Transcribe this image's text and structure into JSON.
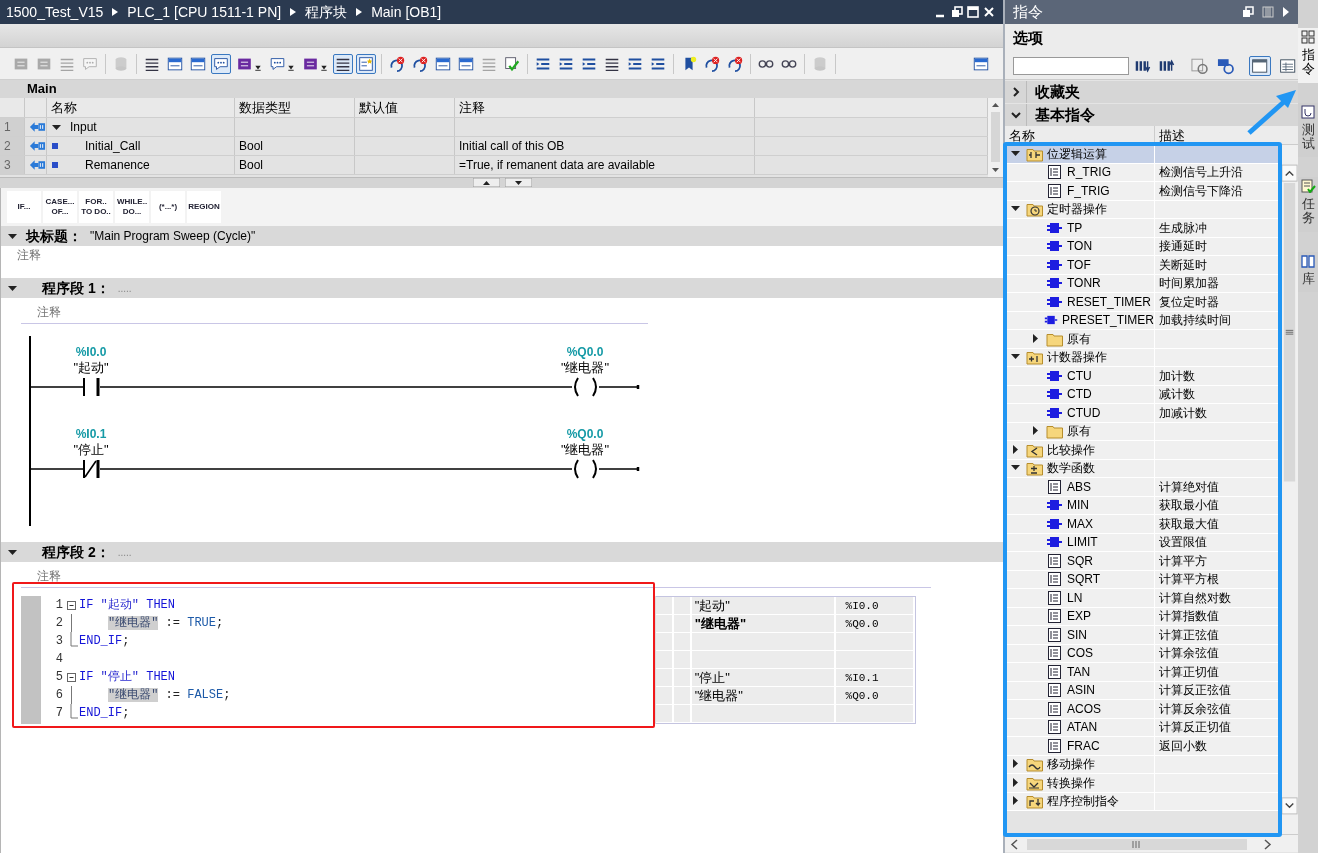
{
  "title_bar": {
    "breadcrumb": [
      "1500_Test_V15",
      "PLC_1 [CPU 1511-1 PN]",
      "程序块",
      "Main [OB1]"
    ]
  },
  "toolbar": [
    {
      "buttons": [
        {
          "on": false,
          "disabled": true,
          "kind": "button"
        },
        {
          "on": false,
          "disabled": true,
          "kind": "button"
        },
        {
          "on": false,
          "disabled": true,
          "kind": "button"
        },
        {
          "on": false,
          "disabled": true,
          "kind": "button"
        }
      ]
    },
    {
      "buttons": [
        {
          "on": false,
          "disabled": true,
          "kind": "button"
        }
      ]
    },
    {
      "buttons": [
        {
          "on": false,
          "disabled": false,
          "kind": "button"
        },
        {
          "on": false,
          "disabled": false,
          "kind": "button"
        },
        {
          "on": false,
          "disabled": false,
          "kind": "button"
        },
        {
          "on": true,
          "disabled": false,
          "kind": "button"
        },
        {
          "on": false,
          "disabled": false,
          "kind": "dropdown"
        },
        {
          "on": false,
          "disabled": false,
          "kind": "dropdown"
        },
        {
          "on": false,
          "disabled": false,
          "kind": "dropdown"
        },
        {
          "on": true,
          "disabled": false,
          "kind": "button"
        },
        {
          "on": true,
          "disabled": false,
          "kind": "button"
        }
      ]
    },
    {
      "buttons": [
        {
          "on": false,
          "disabled": false,
          "kind": "button"
        },
        {
          "on": false,
          "disabled": false,
          "kind": "button"
        },
        {
          "on": false,
          "disabled": false,
          "kind": "button"
        },
        {
          "on": false,
          "disabled": false,
          "kind": "button"
        },
        {
          "on": false,
          "disabled": true,
          "kind": "button"
        },
        {
          "on": false,
          "disabled": false,
          "kind": "button"
        }
      ]
    },
    {
      "buttons": [
        {
          "on": false,
          "disabled": false,
          "kind": "button"
        },
        {
          "on": false,
          "disabled": false,
          "kind": "button"
        },
        {
          "on": false,
          "disabled": false,
          "kind": "button"
        },
        {
          "on": false,
          "disabled": false,
          "kind": "button"
        },
        {
          "on": false,
          "disabled": false,
          "kind": "button"
        },
        {
          "on": false,
          "disabled": false,
          "kind": "button"
        }
      ]
    },
    {
      "buttons": [
        {
          "on": false,
          "disabled": false,
          "kind": "button"
        },
        {
          "on": false,
          "disabled": false,
          "kind": "button"
        },
        {
          "on": false,
          "disabled": false,
          "kind": "button"
        }
      ]
    },
    {
      "buttons": [
        {
          "on": false,
          "disabled": false,
          "kind": "button"
        },
        {
          "on": false,
          "disabled": false,
          "kind": "button"
        }
      ]
    },
    {
      "buttons": [
        {
          "on": false,
          "disabled": true,
          "kind": "button"
        }
      ]
    },
    {
      "buttons": [
        {
          "on": false,
          "disabled": false,
          "kind": "button"
        }
      ]
    }
  ],
  "interface": {
    "title": "Main",
    "columns": [
      "名称",
      "数据类型",
      "默认值",
      "注释"
    ],
    "rows": [
      {
        "number": "1",
        "kind": "section",
        "expanded": true,
        "name": "Input"
      },
      {
        "number": "2",
        "kind": "member",
        "name": "Initial_Call",
        "type": "Bool",
        "comment": "Initial call of this OB"
      },
      {
        "number": "3",
        "kind": "member",
        "name": "Remanence",
        "type": "Bool",
        "comment": "=True, if remanent data are available"
      }
    ]
  },
  "snippet_buttons": [
    {
      "lines": [
        "IF..."
      ]
    },
    {
      "lines": [
        "CASE...",
        "OF..."
      ]
    },
    {
      "lines": [
        "FOR..",
        "TO DO.."
      ]
    },
    {
      "lines": [
        "WHILE..",
        "DO..."
      ]
    },
    {
      "lines": [
        "(*...*)"
      ]
    },
    {
      "lines": [
        "REGION"
      ]
    }
  ],
  "block_title": {
    "expanded": true,
    "label": "块标题：",
    "value": "\"Main Program Sweep (Cycle)\"",
    "comment": "注释"
  },
  "networks": [
    {
      "kind": "ladder",
      "expanded": true,
      "label": "程序段 1：",
      "title": ".....",
      "comment": "注释",
      "rungs": [
        {
          "contact": {
            "kind": "normally_open",
            "address": "%I0.0",
            "symbol": "\"起动\""
          },
          "coil": {
            "address": "%Q0.0",
            "symbol": "\"继电器\""
          }
        },
        {
          "contact": {
            "kind": "normally_closed",
            "address": "%I0.1",
            "symbol": "\"停止\""
          },
          "coil": {
            "address": "%Q0.0",
            "symbol": "\"继电器\""
          }
        }
      ]
    },
    {
      "kind": "scl",
      "expanded": true,
      "label": "程序段 2：",
      "title": ".....",
      "comment": "注释",
      "lines": [
        {
          "number": "1",
          "fold": {
            "kind": "start"
          },
          "indented": false,
          "tokens": [
            {
              "t": "IF ",
              "kind": "keyword"
            },
            {
              "t": "\"起动\"",
              "kind": "symbol"
            },
            {
              "t": " THEN",
              "kind": "keyword"
            }
          ],
          "symbol": {
            "name": "\"起动\"",
            "address": "%I0.0",
            "bold": false
          }
        },
        {
          "number": "2",
          "fold": {
            "kind": "mid"
          },
          "indented": true,
          "tokens": [
            {
              "t": "\"继电器\"",
              "kind": "highlighted"
            },
            {
              "t": " := ",
              "kind": "op"
            },
            {
              "t": "TRUE",
              "kind": "constant"
            },
            {
              "t": ";",
              "kind": "op"
            }
          ],
          "symbol": {
            "name": "\"继电器\"",
            "address": "%Q0.0",
            "bold": true
          }
        },
        {
          "number": "3",
          "fold": {
            "kind": "end"
          },
          "indented": false,
          "tokens": [
            {
              "t": "END_IF",
              "kind": "keyword"
            },
            {
              "t": ";",
              "kind": "op"
            }
          ]
        },
        {
          "number": "4"
        },
        {
          "number": "5",
          "fold": {
            "kind": "start"
          },
          "indented": false,
          "tokens": [
            {
              "t": "IF ",
              "kind": "keyword"
            },
            {
              "t": "\"停止\"",
              "kind": "symbol"
            },
            {
              "t": " THEN",
              "kind": "keyword"
            }
          ],
          "symbol": {
            "name": "\"停止\"",
            "address": "%I0.1",
            "bold": false
          }
        },
        {
          "number": "6",
          "fold": {
            "kind": "mid"
          },
          "indented": true,
          "tokens": [
            {
              "t": "\"继电器\"",
              "kind": "highlighted"
            },
            {
              "t": " := ",
              "kind": "op"
            },
            {
              "t": "FALSE",
              "kind": "constant"
            },
            {
              "t": ";",
              "kind": "op"
            }
          ],
          "symbol": {
            "name": "\"继电器\"",
            "address": "%Q0.0",
            "bold": false
          }
        },
        {
          "number": "7",
          "fold": {
            "kind": "end"
          },
          "indented": false,
          "tokens": [
            {
              "t": "END_IF",
              "kind": "keyword"
            },
            {
              "t": ";",
              "kind": "op"
            }
          ]
        }
      ]
    }
  ],
  "instructions_panel": {
    "title": "指令",
    "options_label": "选项",
    "view_buttons": [
      {
        "on": true
      },
      {
        "on": false
      }
    ],
    "sections": [
      {
        "label": "收藏夹",
        "expanded": false
      },
      {
        "label": "基本指令",
        "expanded": true
      }
    ],
    "columns": [
      "名称",
      "描述"
    ],
    "tree": [
      {
        "label": "位逻辑运算",
        "kind": "bit_logic",
        "expanded": true,
        "selected": true,
        "children": [
          {
            "label": "R_TRIG",
            "description": "检测信号上升沿",
            "kind": "function",
            "selected": false
          },
          {
            "label": "F_TRIG",
            "description": "检测信号下降沿",
            "kind": "function",
            "selected": false
          }
        ]
      },
      {
        "label": "定时器操作",
        "kind": "timer",
        "expanded": true,
        "selected": false,
        "children": [
          {
            "label": "TP",
            "description": "生成脉冲",
            "kind": "box",
            "selected": false
          },
          {
            "label": "TON",
            "description": "接通延时",
            "kind": "box",
            "selected": false
          },
          {
            "label": "TOF",
            "description": "关断延时",
            "kind": "box",
            "selected": false
          },
          {
            "label": "TONR",
            "description": "时间累加器",
            "kind": "box",
            "selected": false
          },
          {
            "label": "RESET_TIMER",
            "description": "复位定时器",
            "kind": "box",
            "selected": false
          },
          {
            "label": "PRESET_TIMER",
            "description": "加载持续时间",
            "kind": "box",
            "selected": false
          },
          {
            "label": "原有",
            "kind": "folder",
            "expanded": false,
            "selected": false
          }
        ]
      },
      {
        "label": "计数器操作",
        "kind": "counter",
        "expanded": true,
        "selected": false,
        "children": [
          {
            "label": "CTU",
            "description": "加计数",
            "kind": "box",
            "selected": false
          },
          {
            "label": "CTD",
            "description": "减计数",
            "kind": "box",
            "selected": false
          },
          {
            "label": "CTUD",
            "description": "加减计数",
            "kind": "box",
            "selected": false
          },
          {
            "label": "原有",
            "kind": "folder",
            "expanded": false,
            "selected": false
          }
        ]
      },
      {
        "label": "比较操作",
        "kind": "compare",
        "expanded": false,
        "selected": false
      },
      {
        "label": "数学函数",
        "kind": "math",
        "expanded": true,
        "selected": false,
        "children": [
          {
            "label": "ABS",
            "description": "计算绝对值",
            "kind": "function",
            "selected": false
          },
          {
            "label": "MIN",
            "description": "获取最小值",
            "kind": "box",
            "selected": false
          },
          {
            "label": "MAX",
            "description": "获取最大值",
            "kind": "box",
            "selected": false
          },
          {
            "label": "LIMIT",
            "description": "设置限值",
            "kind": "box",
            "selected": false
          },
          {
            "label": "SQR",
            "description": "计算平方",
            "kind": "function",
            "selected": false
          },
          {
            "label": "SQRT",
            "description": "计算平方根",
            "kind": "function",
            "selected": false
          },
          {
            "label": "LN",
            "description": "计算自然对数",
            "kind": "function",
            "selected": false
          },
          {
            "label": "EXP",
            "description": "计算指数值",
            "kind": "function",
            "selected": false
          },
          {
            "label": "SIN",
            "description": "计算正弦值",
            "kind": "function",
            "selected": false
          },
          {
            "label": "COS",
            "description": "计算余弦值",
            "kind": "function",
            "selected": false
          },
          {
            "label": "TAN",
            "description": "计算正切值",
            "kind": "function",
            "selected": false
          },
          {
            "label": "ASIN",
            "description": "计算反正弦值",
            "kind": "function",
            "selected": false
          },
          {
            "label": "ACOS",
            "description": "计算反余弦值",
            "kind": "function",
            "selected": false
          },
          {
            "label": "ATAN",
            "description": "计算反正切值",
            "kind": "function",
            "selected": false
          },
          {
            "label": "FRAC",
            "description": "返回小数",
            "kind": "function",
            "selected": false
          }
        ]
      },
      {
        "label": "移动操作",
        "kind": "move",
        "expanded": false,
        "selected": false
      },
      {
        "label": "转换操作",
        "kind": "convert",
        "expanded": false,
        "selected": false
      },
      {
        "label": "程序控制指令",
        "kind": "control",
        "expanded": false,
        "selected": false
      }
    ]
  },
  "side_tabs": [
    {
      "label": "指令",
      "kind": "instructions",
      "selected": true
    },
    {
      "label": "测试",
      "kind": "testing",
      "selected": false
    },
    {
      "label": "任务",
      "kind": "tasks",
      "selected": false
    },
    {
      "label": "库",
      "kind": "libraries",
      "selected": false
    }
  ]
}
